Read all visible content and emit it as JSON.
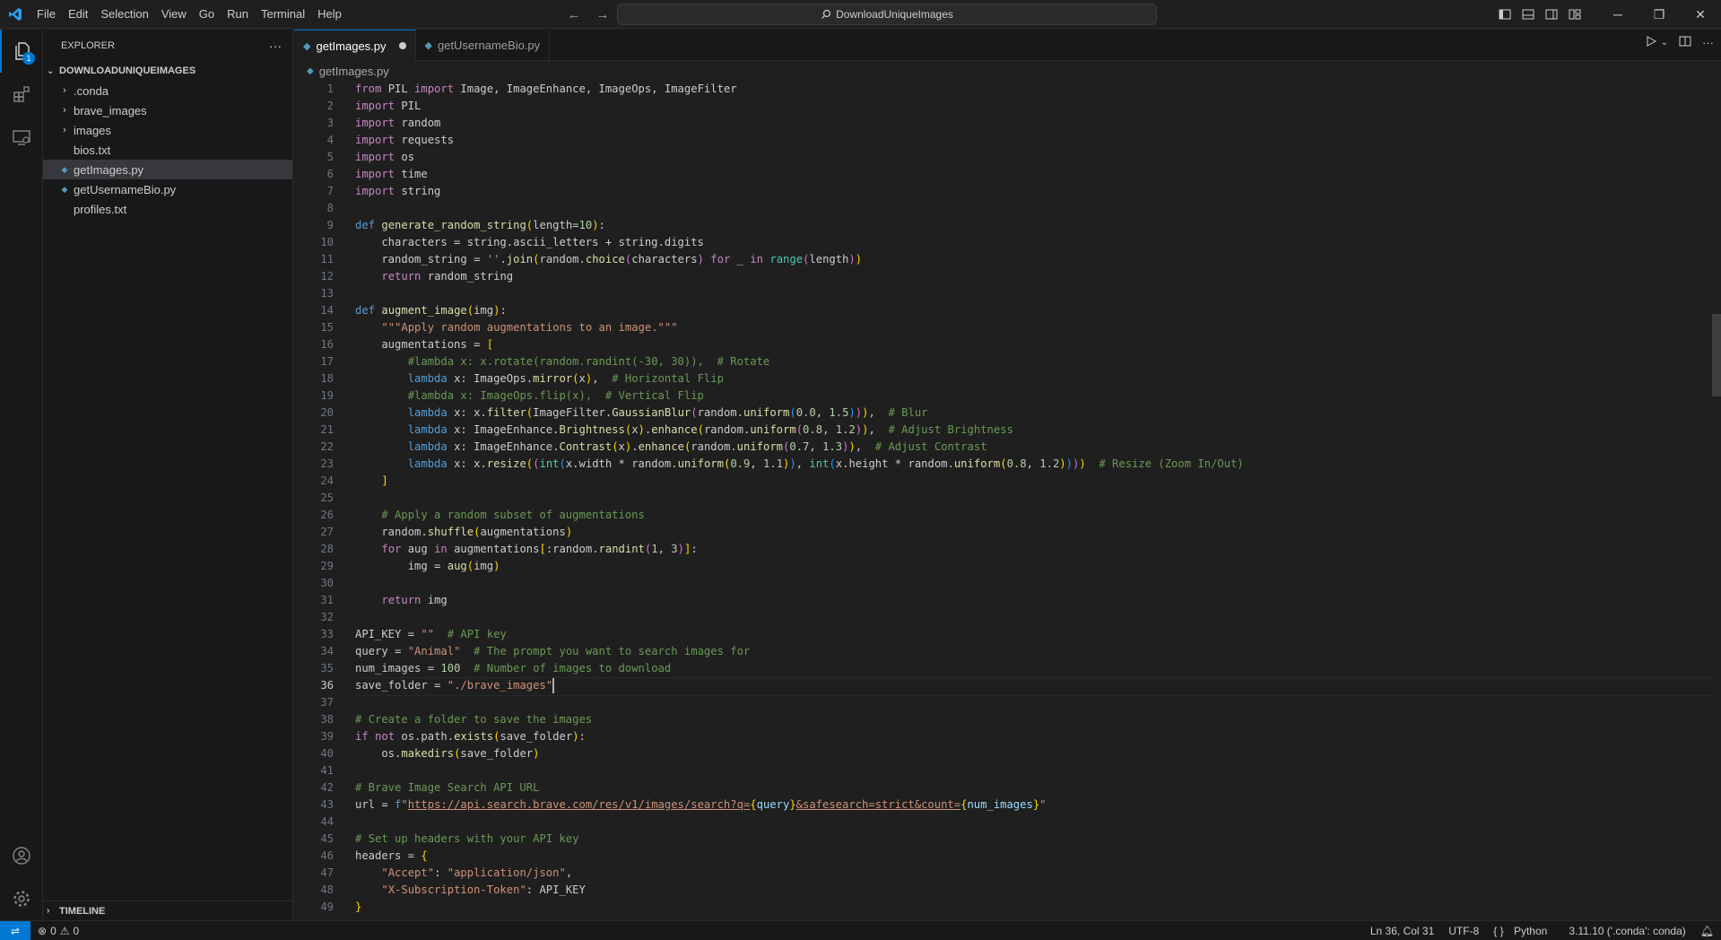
{
  "titlebar": {
    "menu": [
      "File",
      "Edit",
      "Selection",
      "View",
      "Go",
      "Run",
      "Terminal",
      "Help"
    ],
    "search_text": "DownloadUniqueImages"
  },
  "activity": {
    "explorer_badge": "1"
  },
  "sidebar": {
    "header": "EXPLORER",
    "more": "···",
    "project": "DOWNLOADUNIQUEIMAGES",
    "items": [
      {
        "label": ".conda",
        "type": "folder"
      },
      {
        "label": "brave_images",
        "type": "folder"
      },
      {
        "label": "images",
        "type": "folder"
      },
      {
        "label": "bios.txt",
        "type": "text"
      },
      {
        "label": "getImages.py",
        "type": "python",
        "selected": true
      },
      {
        "label": "getUsernameBio.py",
        "type": "python"
      },
      {
        "label": "profiles.txt",
        "type": "text"
      }
    ],
    "timeline": "TIMELINE"
  },
  "tabs": [
    {
      "label": "getImages.py",
      "active": true,
      "modified": true
    },
    {
      "label": "getUsernameBio.py",
      "active": false
    }
  ],
  "breadcrumb": "getImages.py",
  "editor": {
    "cursor_line": 36,
    "lines": [
      "from PIL import Image, ImageEnhance, ImageOps, ImageFilter",
      "import PIL",
      "import random",
      "import requests",
      "import os",
      "import time",
      "import string",
      "",
      "def generate_random_string(length=10):",
      "    characters = string.ascii_letters + string.digits",
      "    random_string = ''.join(random.choice(characters) for _ in range(length))",
      "    return random_string",
      "",
      "def augment_image(img):",
      "    \"\"\"Apply random augmentations to an image.\"\"\"",
      "    augmentations = [",
      "        #lambda x: x.rotate(random.randint(-30, 30)),  # Rotate",
      "        lambda x: ImageOps.mirror(x),  # Horizontal Flip",
      "        #lambda x: ImageOps.flip(x),  # Vertical Flip",
      "        lambda x: x.filter(ImageFilter.GaussianBlur(random.uniform(0.0, 1.5))),  # Blur",
      "        lambda x: ImageEnhance.Brightness(x).enhance(random.uniform(0.8, 1.2)),  # Adjust Brightness",
      "        lambda x: ImageEnhance.Contrast(x).enhance(random.uniform(0.7, 1.3)),  # Adjust Contrast",
      "        lambda x: x.resize((int(x.width * random.uniform(0.9, 1.1)), int(x.height * random.uniform(0.8, 1.2))))  # Resize (Zoom In/Out)",
      "    ]",
      "",
      "    # Apply a random subset of augmentations",
      "    random.shuffle(augmentations)",
      "    for aug in augmentations[:random.randint(1, 3)]:",
      "        img = aug(img)",
      "",
      "    return img",
      "",
      "API_KEY = \"\"  # API key",
      "query = \"Animal\"  # The prompt you want to search images for",
      "num_images = 100  # Number of images to download",
      "save_folder = \"./brave_images\"",
      "",
      "# Create a folder to save the images",
      "if not os.path.exists(save_folder):",
      "    os.makedirs(save_folder)",
      "",
      "# Brave Image Search API URL",
      "url = f\"https://api.search.brave.com/res/v1/images/search?q={query}&safesearch=strict&count={num_images}\"",
      "",
      "# Set up headers with your API key",
      "headers = {",
      "    \"Accept\": \"application/json\",",
      "    \"X-Subscription-Token\": API_KEY",
      "}"
    ]
  },
  "status": {
    "errors": "0",
    "warnings": "0",
    "position": "Ln 36, Col 31",
    "encoding": "UTF-8",
    "language": "Python",
    "interpreter": "3.11.10 ('.conda': conda)"
  },
  "colors": {
    "accent": "#0078d4",
    "keyword": "#c586c0",
    "string": "#ce9178",
    "comment": "#6a9955",
    "function": "#dcdcaa"
  }
}
